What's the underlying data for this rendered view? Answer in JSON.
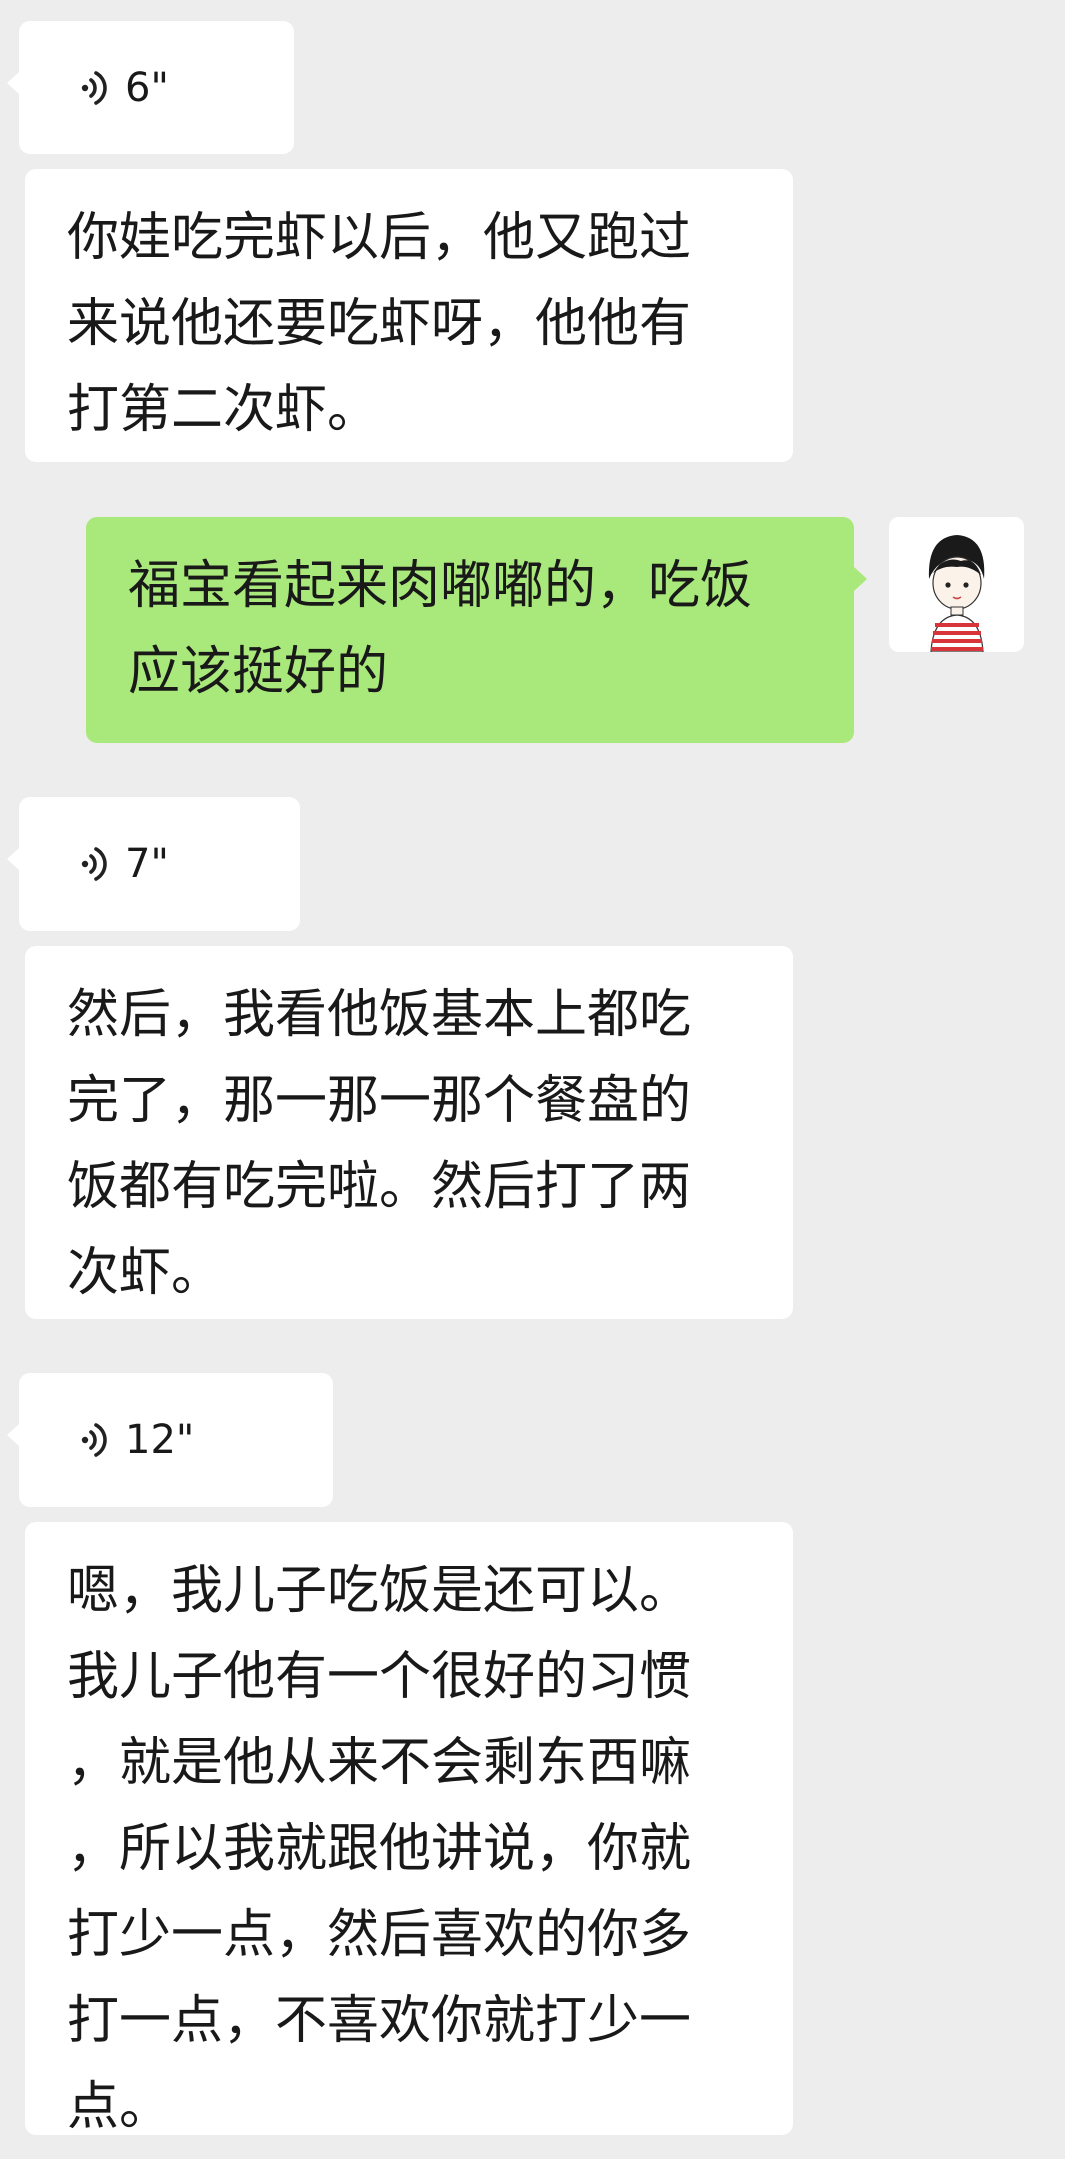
{
  "messages": [
    {
      "type": "voice",
      "duration": "6\"",
      "transcript": "你娃吃完虾以后，他又跑过\n来说他还要吃虾呀，他他有\n打第二次虾。"
    },
    {
      "type": "text",
      "direction": "outgoing",
      "text": "福宝看起来肉嘟嘟的，吃饭\n应该挺好的",
      "avatar": "cartoon-child-avatar"
    },
    {
      "type": "voice",
      "duration": "7\"",
      "transcript": "然后，我看他饭基本上都吃\n完了，那一那一那个餐盘的\n饭都有吃完啦。然后打了两\n次虾。"
    },
    {
      "type": "voice",
      "duration": "12\"",
      "transcript": "嗯，我儿子吃饭是还可以。\n我儿子他有一个很好的习惯\n，就是他从来不会剩东西嘛\n，所以我就跟他讲说，你就\n打少一点，然后喜欢的你多\n打一点，不喜欢你就打少一\n点。"
    }
  ],
  "colors": {
    "background": "#ededed",
    "incoming": "#ffffff",
    "outgoing": "#a9e87a"
  }
}
